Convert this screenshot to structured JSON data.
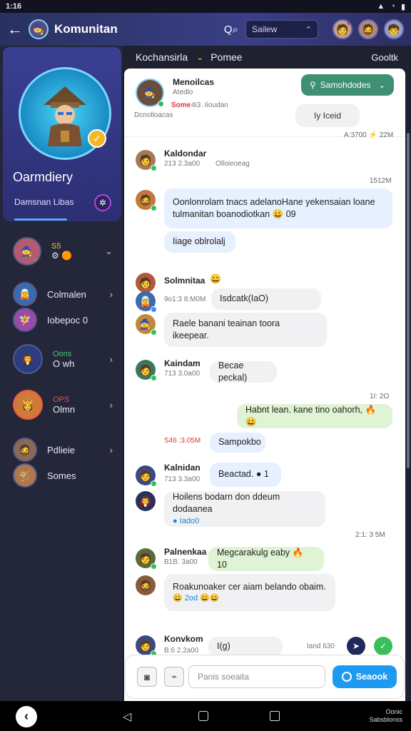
{
  "status": {
    "time": "1:16"
  },
  "appbar": {
    "title": "Komunitan",
    "search_label": "Sailew"
  },
  "sidebar": {
    "profile_name": "Oarmdiery",
    "profile_sub": "Damsnan Libas",
    "items": [
      {
        "title": "S5",
        "sub": "",
        "avatar": "🧙"
      },
      {
        "title": "Colmalen",
        "sub": "",
        "avatar": "🧝"
      },
      {
        "title": "Iobepoc 0",
        "sub": "",
        "avatar": "🧚"
      },
      {
        "title": "Oons",
        "sub": "O wh",
        "avatar": "🧛"
      },
      {
        "title": "OPS",
        "sub": "Olmn",
        "avatar": "👸"
      },
      {
        "title": "Pdlieie",
        "sub": "",
        "avatar": "🧔"
      },
      {
        "title": "Somes",
        "sub": "",
        "avatar": "🐒"
      }
    ]
  },
  "main": {
    "header_left": "Kochansirla",
    "header_sort": "Pomee",
    "header_right": "Gooltk"
  },
  "pinned": {
    "name": "Menoilcas",
    "sub": "Atedlo",
    "tag": "Some",
    "tag_rest": "4i3 .Iioudan",
    "desc": "Dcnolloacas",
    "action_label": "Samohdodes",
    "secondary_label": "Iy Iceid",
    "time": "A:3700 ⚡ 22M"
  },
  "messages": [
    {
      "name": "Kaldondar",
      "meta": "213 2.3a00",
      "meta2": "Olloieoeag",
      "time": "1512M"
    },
    {
      "text1": "Oonlonrolam tnacs adelanoHane yekensaian loane",
      "text2": "tulmanitan boanodiotkan 😀 09",
      "chip": "Iiage oblrolalj"
    },
    {
      "name": "Solmnitaa",
      "meta": "9o1:3 8:M0M",
      "bubble": "Isdcatk(IaO)",
      "text": "Raele banani teainan toora ikeepear."
    },
    {
      "name": "Kaindam",
      "meta": "713 3.0a00",
      "bubble": "Becae peckal)"
    },
    {
      "time": "1I: 2O",
      "text": "Habnt lean. kane tino oahorh, 🔥😀"
    },
    {
      "meta": "S46 :3.05M",
      "bubble": "Sampokbo"
    },
    {
      "name": "Kalnidan",
      "meta": "713 3.3a00",
      "bubble": "Beactad. ● 1",
      "text": "Hoilens bodarn don ddeum dodaanea",
      "sub": "● Iado0"
    },
    {
      "time": "2:1: 3 5M",
      "name": "Palnenkaa",
      "meta": "B1B. 3a00",
      "bubble": "Megcarakulg eaby 🔥 10",
      "text": "Roakunoaker cer aiam belando obaim.",
      "sub": "😀 2od 😀😀"
    },
    {
      "name": "Konvkom",
      "meta": "B:6 2.2a00",
      "bubble": "I(g)",
      "bubble_right": "Iand 630"
    }
  ],
  "composer": {
    "placeholder": "Panis soeaita",
    "send_label": "Seaook"
  },
  "navbar": {
    "label": "Oonic Sabsblonss"
  }
}
